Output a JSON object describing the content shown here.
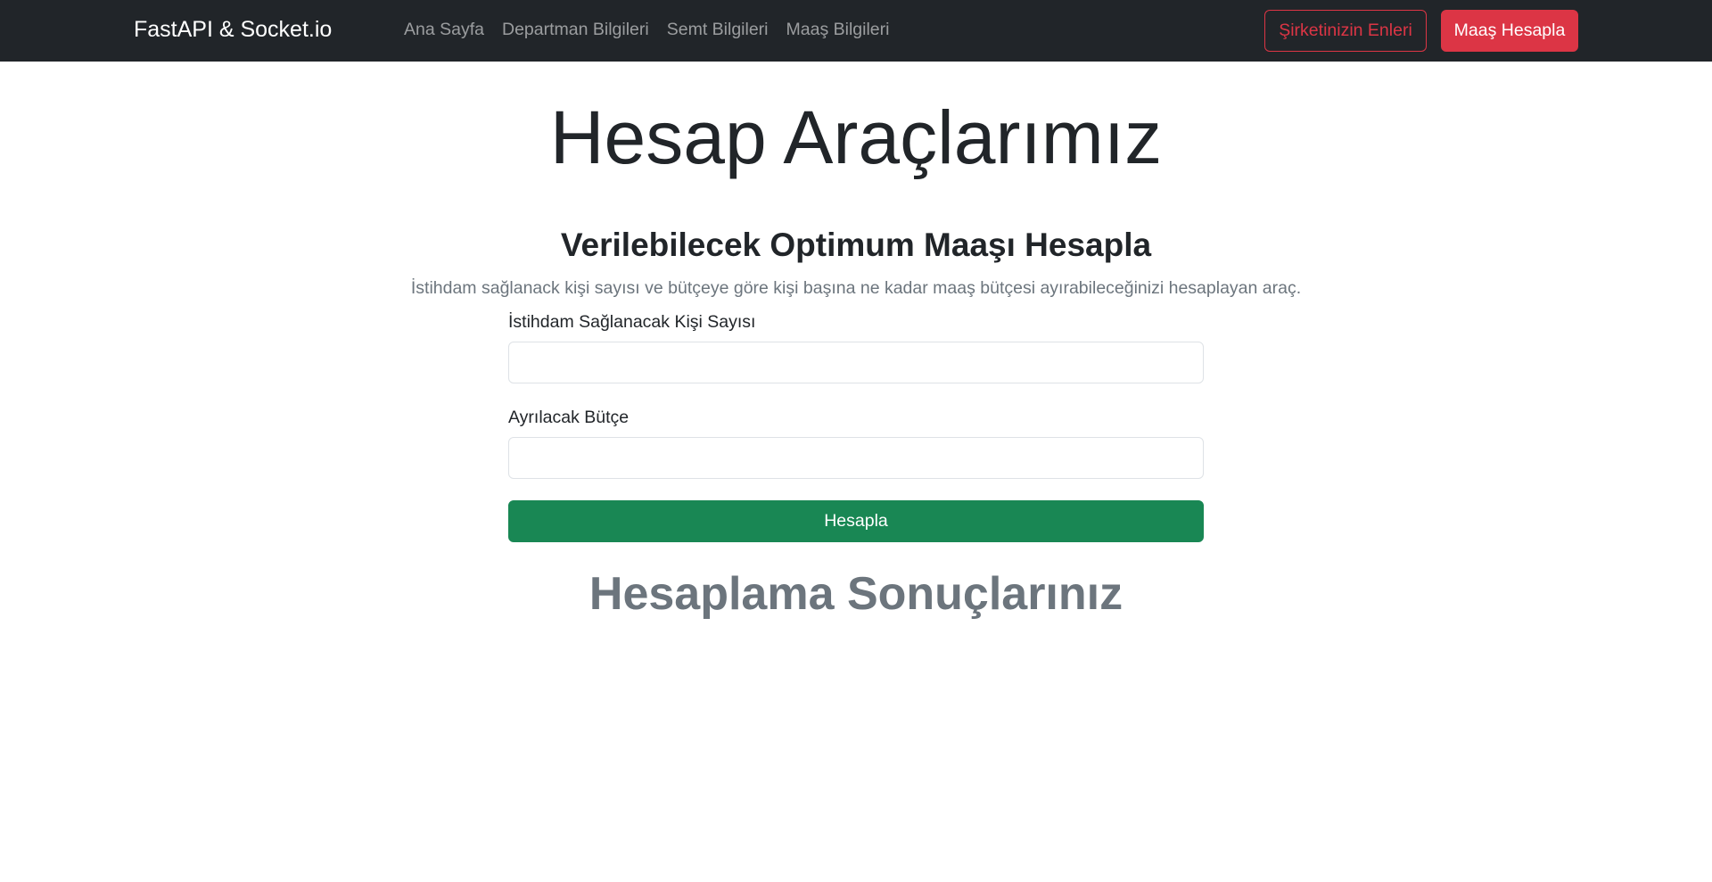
{
  "navbar": {
    "brand": "FastAPI & Socket.io",
    "links": [
      {
        "label": "Ana Sayfa"
      },
      {
        "label": "Departman Bilgileri"
      },
      {
        "label": "Semt Bilgileri"
      },
      {
        "label": "Maaş Bilgileri"
      }
    ],
    "outline_button": "Şirketinizin Enleri",
    "primary_button": "Maaş Hesapla"
  },
  "page": {
    "title": "Hesap Araçlarımız"
  },
  "calculator": {
    "title": "Verilebilecek Optimum Maaşı Hesapla",
    "description": "İstihdam sağlanack kişi sayısı ve bütçeye göre kişi başına ne kadar maaş bütçesi ayırabileceğinizi hesaplayan araç.",
    "people_label": "İstihdam Sağlanacak Kişi Sayısı",
    "people_value": "",
    "budget_label": "Ayrılacak Bütçe",
    "budget_value": "",
    "submit_label": "Hesapla"
  },
  "results": {
    "title": "Hesaplama Sonuçlarınız"
  },
  "colors": {
    "navbar_bg": "#212529",
    "danger": "#dc3545",
    "success": "#198754",
    "muted": "#6c757d"
  }
}
